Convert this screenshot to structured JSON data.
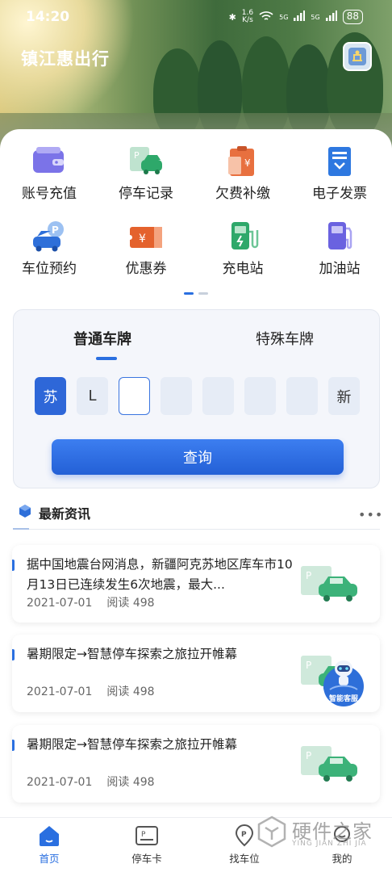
{
  "status_bar": {
    "time": "14:20",
    "net_speed_top": "1.6",
    "net_speed_unit": "K/s",
    "signal_1": "5G",
    "signal_2": "5G",
    "battery": "88"
  },
  "header": {
    "title": "镇江惠出行"
  },
  "services": [
    {
      "label": "账号充值",
      "icon": "wallet-icon"
    },
    {
      "label": "停车记录",
      "icon": "parking-record-icon"
    },
    {
      "label": "欠费补缴",
      "icon": "arrears-payment-icon"
    },
    {
      "label": "电子发票",
      "icon": "e-invoice-icon"
    },
    {
      "label": "车位预约",
      "icon": "space-reservation-icon"
    },
    {
      "label": "优惠券",
      "icon": "coupon-icon"
    },
    {
      "label": "充电站",
      "icon": "charging-station-icon"
    },
    {
      "label": "加油站",
      "icon": "gas-station-icon"
    }
  ],
  "plate": {
    "tabs": [
      {
        "label": "普通车牌"
      },
      {
        "label": "特殊车牌"
      }
    ],
    "province": "苏",
    "letter": "L",
    "new_energy": "新",
    "query_label": "查询"
  },
  "news": {
    "section_title": "最新资讯",
    "items": [
      {
        "title": "据中国地震台网消息，新疆阿克苏地区库车市10月13日已连续发生6次地震，最大...",
        "date": "2021-07-01",
        "reads": "阅读 498"
      },
      {
        "title": "暑期限定→智慧停车探索之旅拉开帷幕",
        "date": "2021-07-01",
        "reads": "阅读 498"
      },
      {
        "title": "暑期限定→智慧停车探索之旅拉开帷幕",
        "date": "2021-07-01",
        "reads": "阅读 498"
      }
    ]
  },
  "fab": {
    "label": "智能客服"
  },
  "tabbar": [
    {
      "label": "首页"
    },
    {
      "label": "停车卡"
    },
    {
      "label": "找车位"
    },
    {
      "label": "我的"
    }
  ],
  "watermark": {
    "text": "硬件之家",
    "sub": "YING JIAN ZHI JIA"
  },
  "colors": {
    "accent": "#2A6FE0",
    "card": "#FFFFFF"
  }
}
